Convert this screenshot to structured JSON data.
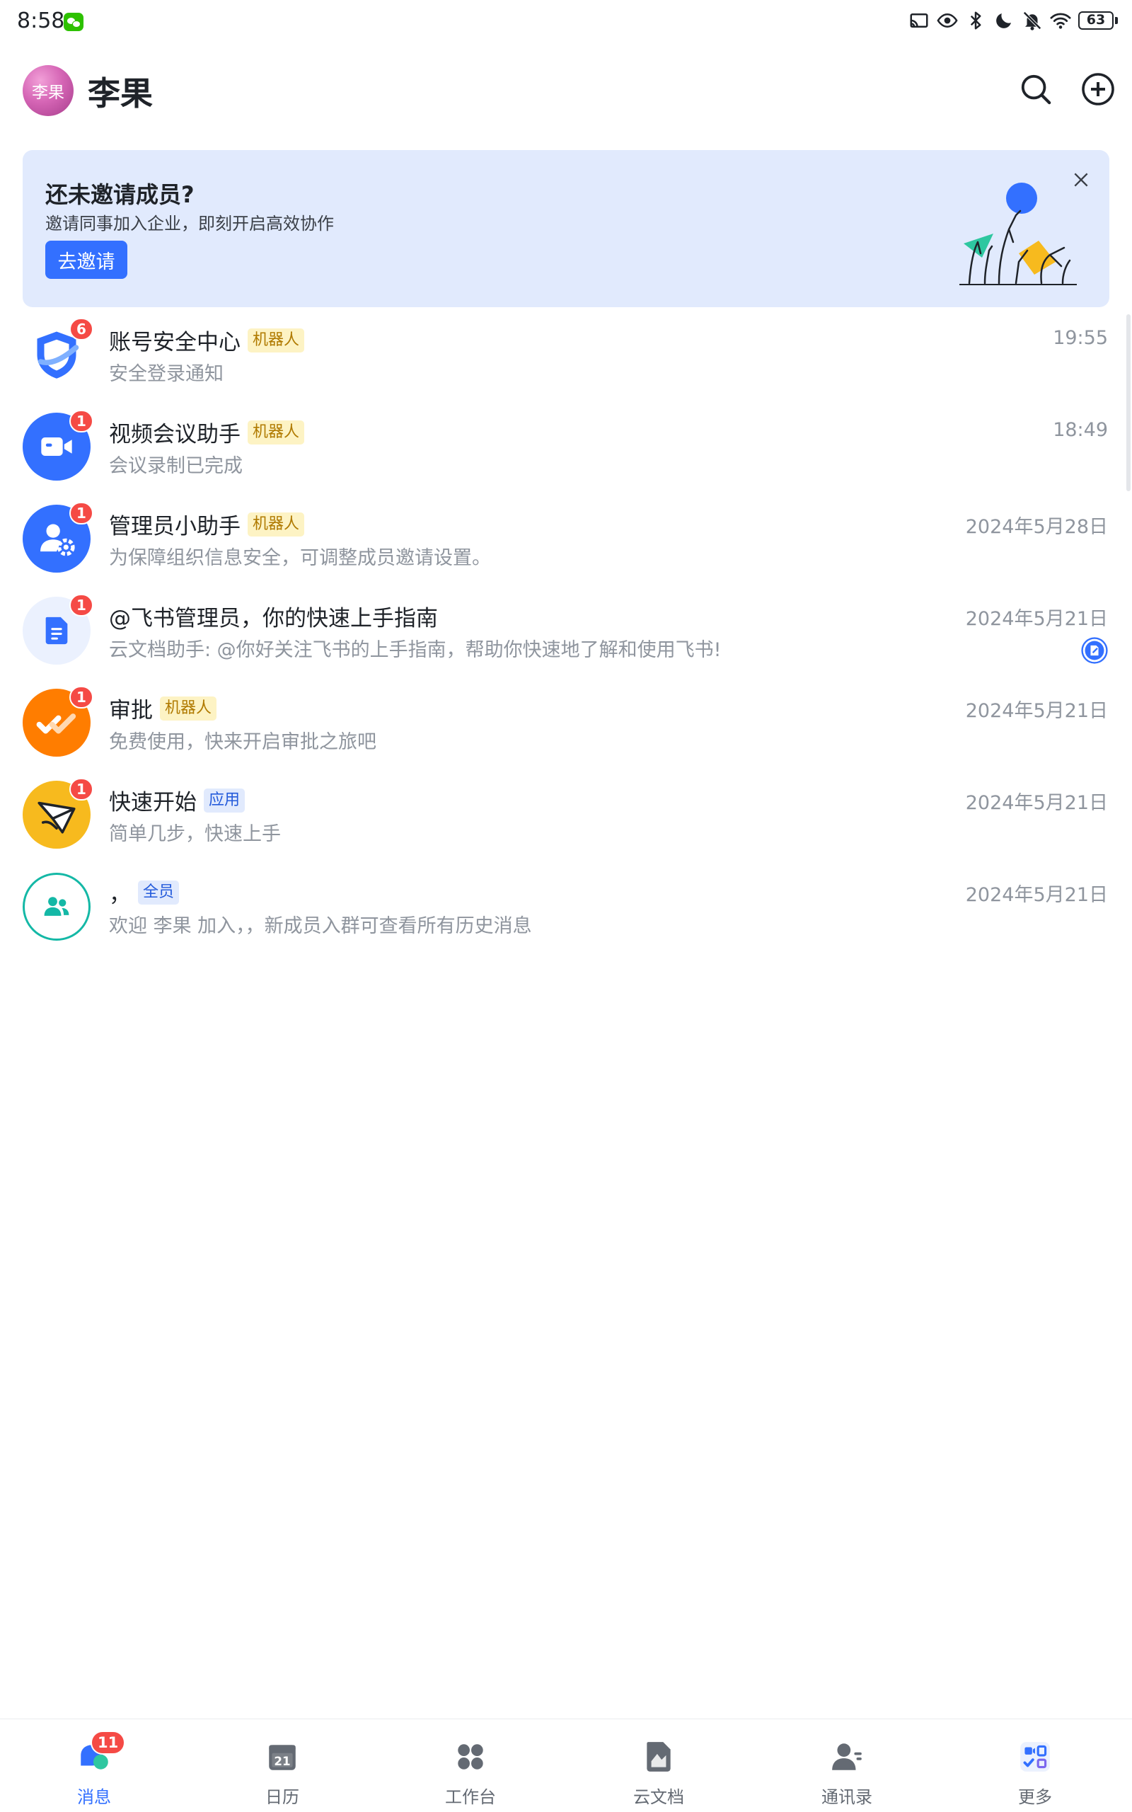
{
  "status_bar": {
    "time": "8:58",
    "battery": "63",
    "icons": [
      "wechat-icon",
      "cast-icon",
      "eye-icon",
      "bluetooth-icon",
      "moon-icon",
      "bell-off-icon",
      "wifi-icon",
      "battery-icon"
    ]
  },
  "header": {
    "avatar_text": "李果",
    "title": "李果",
    "icons": [
      "search-icon",
      "plus-circle-icon"
    ]
  },
  "banner": {
    "title": "还未邀请成员?",
    "subtitle": "邀请同事加入企业，即刻开启高效协作",
    "button_label": "去邀请",
    "close_icon": "close-icon"
  },
  "chats": [
    {
      "name": "账号安全中心",
      "tag": "机器人",
      "preview": "安全登录通知",
      "time": "19:55",
      "badge": "6",
      "icon": "shield-icon",
      "color": "#3370ff"
    },
    {
      "name": "视频会议助手",
      "tag": "机器人",
      "preview": "会议录制已完成",
      "time": "18:49",
      "badge": "1",
      "icon": "video-camera-icon",
      "color": "#3370ff"
    },
    {
      "name": "管理员小助手",
      "tag": "机器人",
      "preview": "为保障组织信息安全，可调整成员邀请设置。",
      "time": "2024年5月28日",
      "badge": "1",
      "icon": "admin-settings-icon",
      "color": "#3370ff"
    },
    {
      "name": "@飞书管理员，你的快速上手指南",
      "tag": "",
      "preview": "云文档助手: @你好关注飞书的上手指南，帮助你快速地了解和使用飞书!",
      "time": "2024年5月21日",
      "badge": "1",
      "icon": "document-icon",
      "color": "#3370ff"
    },
    {
      "name": "审批",
      "tag": "机器人",
      "preview": "免费使用，快来开启审批之旅吧",
      "time": "2024年5月21日",
      "badge": "1",
      "icon": "approval-icon",
      "color": "#ff7d00"
    },
    {
      "name": "快速开始",
      "tag": "应用",
      "preview": "简单几步，快速上手",
      "time": "2024年5月21日",
      "badge": "1",
      "icon": "paper-plane-icon",
      "color": "#f7ba1e"
    },
    {
      "name": "，",
      "tag": "全员",
      "preview": "欢迎 李果 加入，，新成员入群可查看所有历史消息",
      "time": "2024年5月21日",
      "badge": "",
      "icon": "group-icon",
      "color": "#14b8a6"
    }
  ],
  "nav": {
    "items": [
      {
        "label": "消息",
        "icon": "message-icon",
        "badge": "11",
        "active": true
      },
      {
        "label": "日历",
        "icon": "calendar-icon",
        "date": "21"
      },
      {
        "label": "工作台",
        "icon": "workplace-icon"
      },
      {
        "label": "云文档",
        "icon": "cloud-doc-icon"
      },
      {
        "label": "通讯录",
        "icon": "contacts-icon"
      },
      {
        "label": "更多",
        "icon": "more-apps-icon"
      }
    ]
  }
}
